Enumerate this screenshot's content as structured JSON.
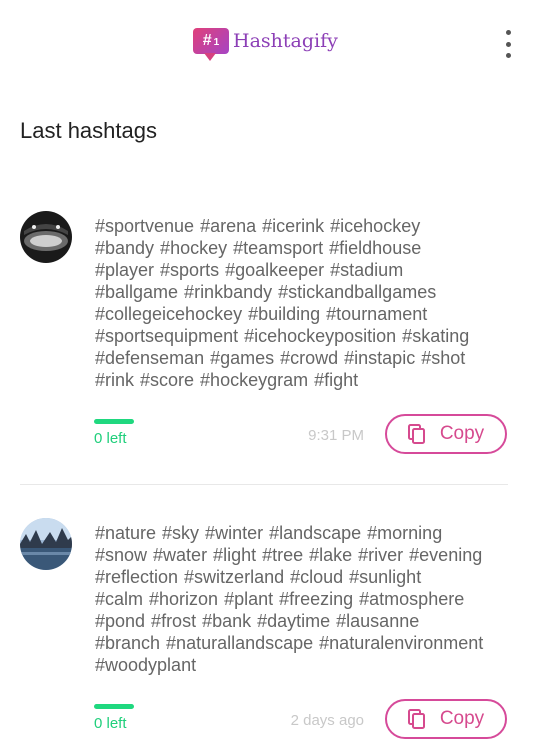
{
  "app": {
    "name": "Hashtagify",
    "badge_symbol": "#",
    "badge_number": "1"
  },
  "header": {
    "menu_icon": "more-vert-icon"
  },
  "section": {
    "title": "Last hashtags"
  },
  "cards": [
    {
      "tags": [
        "#sportvenue #arena #icerink #icehockey",
        "#bandy #hockey #teamsport #fieldhouse",
        "#player #sports #goalkeeper #stadium",
        "#ballgame #rinkbandy #stickandballgames",
        "#collegeicehockey #building #tournament",
        "#sportsequipment #icehockeyposition #skating",
        "#defenseman #games #crowd #instapic #shot",
        "#rink #score #hockeygram #fight"
      ],
      "left_label": "0 left",
      "time": "9:31 PM",
      "copy_label": "Copy"
    },
    {
      "tags": [
        "#nature #sky #winter #landscape #morning",
        "#snow #water #light #tree #lake #river #evening",
        "#reflection #switzerland #cloud #sunlight",
        "#calm #horizon #plant #freezing #atmosphere",
        "#pond #frost #bank #daytime #lausanne",
        "#branch #naturallandscape #naturalenvironment",
        "#woodyplant"
      ],
      "left_label": "0 left",
      "time": "2 days ago",
      "copy_label": "Copy"
    }
  ],
  "colors": {
    "accent_pink": "#d64a9a",
    "accent_purple": "#8c3fb6",
    "progress_green": "#1fd87f",
    "muted_time": "#c8c8c8"
  }
}
